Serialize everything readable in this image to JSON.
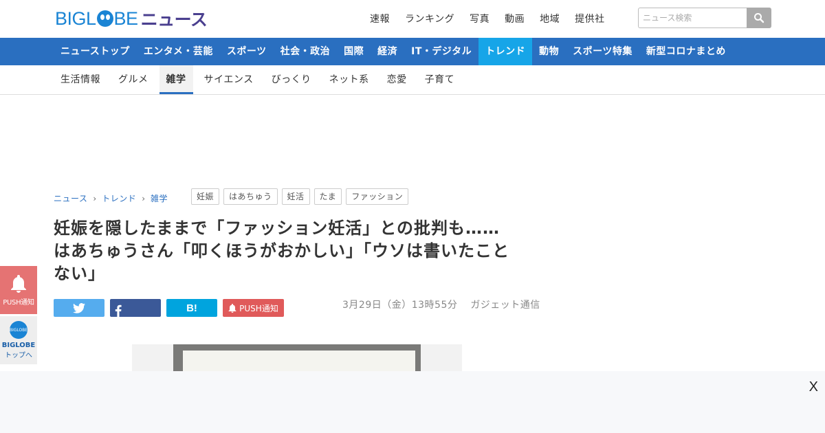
{
  "header": {
    "logo_prefix": "BIGL",
    "logo_suffix": "BE",
    "logo_news": "ニュース",
    "nav": [
      "速報",
      "ランキング",
      "写真",
      "動画",
      "地域",
      "提供社"
    ],
    "search_placeholder": "ニュース検索"
  },
  "categories": [
    {
      "label": "ニューストップ",
      "active": false
    },
    {
      "label": "エンタメ・芸能",
      "active": false
    },
    {
      "label": "スポーツ",
      "active": false
    },
    {
      "label": "社会・政治",
      "active": false
    },
    {
      "label": "国際",
      "active": false
    },
    {
      "label": "経済",
      "active": false
    },
    {
      "label": "IT・デジタル",
      "active": false
    },
    {
      "label": "トレンド",
      "active": true
    },
    {
      "label": "動物",
      "active": false
    },
    {
      "label": "スポーツ特集",
      "active": false
    },
    {
      "label": "新型コロナまとめ",
      "active": false
    }
  ],
  "subnav": [
    {
      "label": "生活情報",
      "active": false
    },
    {
      "label": "グルメ",
      "active": false
    },
    {
      "label": "雑学",
      "active": true
    },
    {
      "label": "サイエンス",
      "active": false
    },
    {
      "label": "びっくり",
      "active": false
    },
    {
      "label": "ネット系",
      "active": false
    },
    {
      "label": "恋愛",
      "active": false
    },
    {
      "label": "子育て",
      "active": false
    }
  ],
  "breadcrumb": [
    "ニュース",
    "トレンド",
    "雑学"
  ],
  "tags": [
    "妊娠",
    "はあちゅう",
    "妊活",
    "たま",
    "ファッション"
  ],
  "article": {
    "title_line1": "妊娠を隠したままで「ファッション妊活」との批判も……",
    "title_line2": "はあちゅうさん「叩くほうがおかしい」「ウソは書いたこと",
    "title_line3": "ない」",
    "date": "3月29日（金）13時55分",
    "source": "ガジェット通信",
    "push_label": "PUSH通知"
  },
  "side": {
    "push_label": "PUSH通知",
    "top_line1": "BIGLOBE",
    "top_line2": "トップへ",
    "logo_text": "BIGLOBE"
  },
  "ad": {
    "close_label": "X"
  },
  "colors": {
    "brand_blue": "#2a6fc0",
    "active_category": "#16a5e8",
    "twitter": "#55acee",
    "facebook": "#3b5998",
    "hatena": "#00a4de",
    "push": "#e05a5a"
  }
}
